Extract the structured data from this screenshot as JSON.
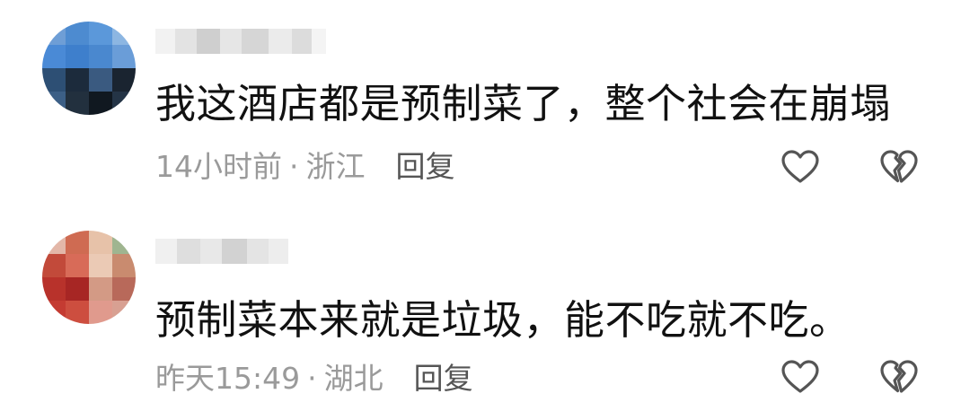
{
  "comments": [
    {
      "text": "我这酒店都是预制菜了，整个社会在崩塌",
      "time": "14小时前",
      "separator": "·",
      "location": "浙江",
      "reply_label": "回复",
      "like_icon": "heart-outline-icon",
      "dislike_icon": "broken-heart-icon"
    },
    {
      "text": "预制菜本来就是垃圾，能不吃就不吃。",
      "time": "昨天15:49",
      "separator": "·",
      "location": "湖北",
      "reply_label": "回复",
      "like_icon": "heart-outline-icon",
      "dislike_icon": "broken-heart-icon"
    }
  ],
  "colors": {
    "text": "#111111",
    "meta": "#9a9a9a",
    "reply": "#555555",
    "icon_stroke": "#555555"
  }
}
